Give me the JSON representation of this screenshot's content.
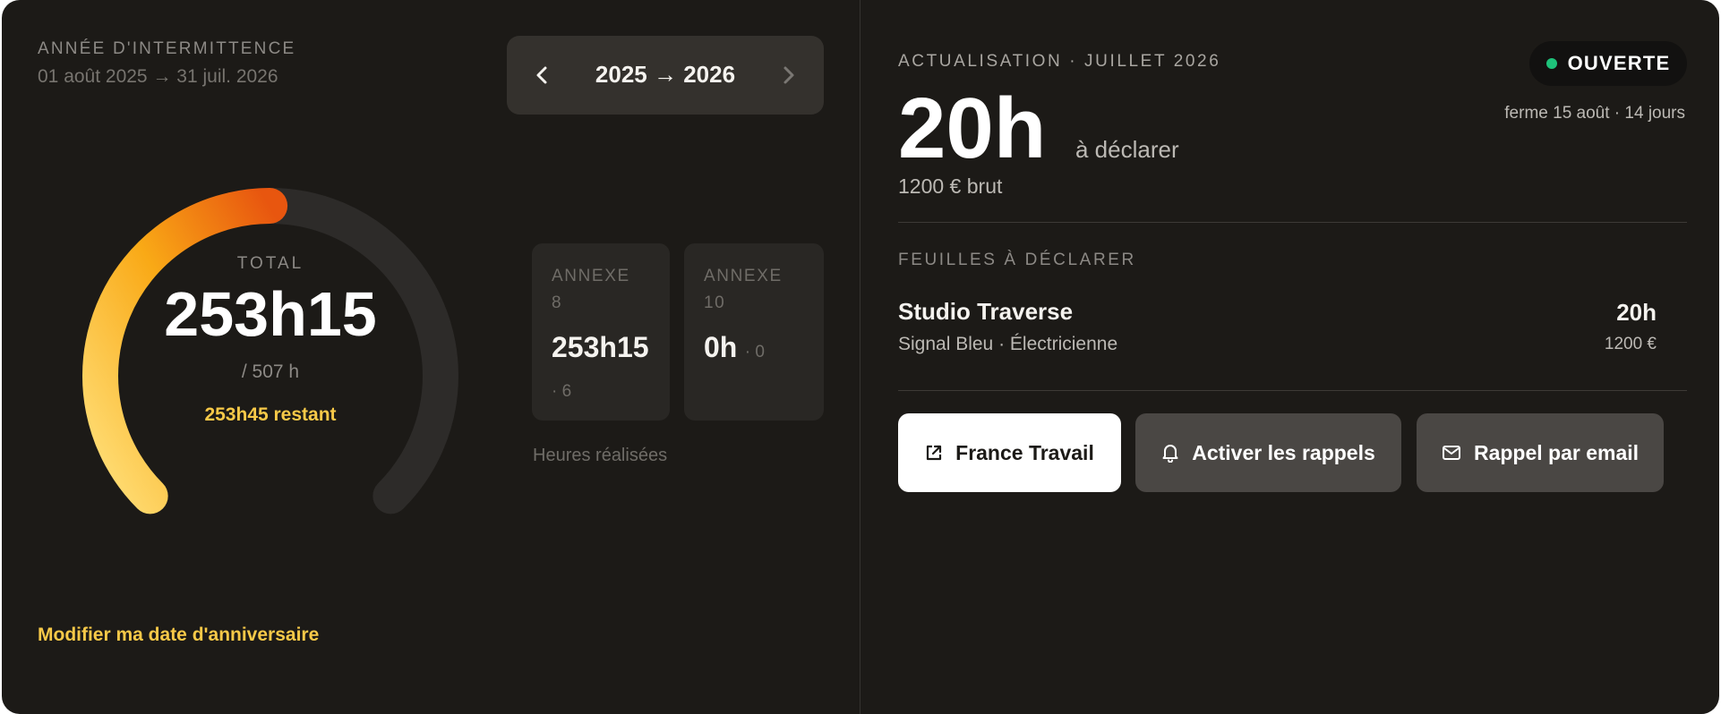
{
  "year": {
    "label": "ANNÉE D'INTERMITTENCE",
    "range": "01 août 2025 → 31 juil. 2026",
    "nav_label": "2025 → 2026"
  },
  "gauge": {
    "total_label": "TOTAL",
    "total_value": "253h15",
    "max_label": "/ 507 h",
    "remaining": "253h45 restant",
    "progress": 0.499
  },
  "annexes": [
    {
      "label": "ANNEXE 8",
      "value": "253h15",
      "count": "· 6"
    },
    {
      "label": "ANNEXE 10",
      "value": "0h",
      "count": "· 0"
    }
  ],
  "heures_label": "Heures réalisées",
  "modify_link": "Modifier ma date d'anniversaire",
  "actualisation": {
    "label": "ACTUALISATION · JUILLET 2026",
    "status": "OUVERTE",
    "close_info": "ferme 15 août · 14 jours",
    "hours": "20h",
    "hours_suffix": "à déclarer",
    "brut": "1200 € brut"
  },
  "sheets": {
    "label": "FEUILLES À DÉCLARER",
    "items": [
      {
        "name": "Studio Traverse",
        "sub": "Signal Bleu · Électricienne",
        "hours": "20h",
        "amount": "1200 €"
      }
    ]
  },
  "buttons": {
    "france_travail": "France Travail",
    "reminders": "Activer les rappels",
    "email": "Rappel par email"
  },
  "colors": {
    "background": "#1c1a17",
    "accent_yellow": "#f7c948",
    "gauge_start": "#ffe07a",
    "gauge_end": "#e8560f",
    "status_green": "#1ec27a"
  },
  "icons": [
    "chevron-left-icon",
    "chevron-right-icon",
    "external-link-icon",
    "bell-icon",
    "mail-icon"
  ]
}
